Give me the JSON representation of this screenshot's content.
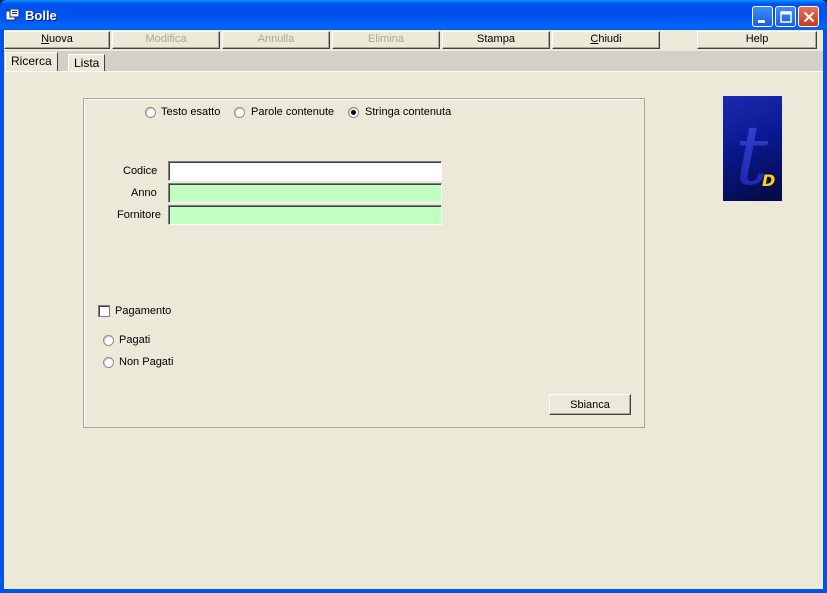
{
  "window": {
    "title": "Bolle",
    "colors": {
      "titlebar": "#0054e3",
      "face": "#ece9d8",
      "field_readonly": "#c0ffc0"
    }
  },
  "toolbar": {
    "nuova": "Nuova",
    "modifica": "Modifica",
    "annulla": "Annulla",
    "elimina": "Elimina",
    "stampa": "Stampa",
    "chiudi": "Chiudi",
    "help": "Help"
  },
  "tabs": {
    "ricerca": "Ricerca",
    "lista": "Lista",
    "active": "Ricerca"
  },
  "search_mode": {
    "options": [
      "Testo esatto",
      "Parole contenute",
      "Stringa contenuta"
    ],
    "selected": "Stringa contenuta"
  },
  "fields": {
    "codice": {
      "label": "Codice",
      "value": ""
    },
    "anno": {
      "label": "Anno",
      "value": ""
    },
    "fornitore": {
      "label": "Fornitore",
      "value": ""
    }
  },
  "pagamento": {
    "label": "Pagamento",
    "checked": false,
    "pagati": "Pagati",
    "non_pagati": "Non Pagati"
  },
  "actions": {
    "sbianca": "Sbianca"
  },
  "logo": {
    "letter": "t",
    "mark": "D"
  }
}
